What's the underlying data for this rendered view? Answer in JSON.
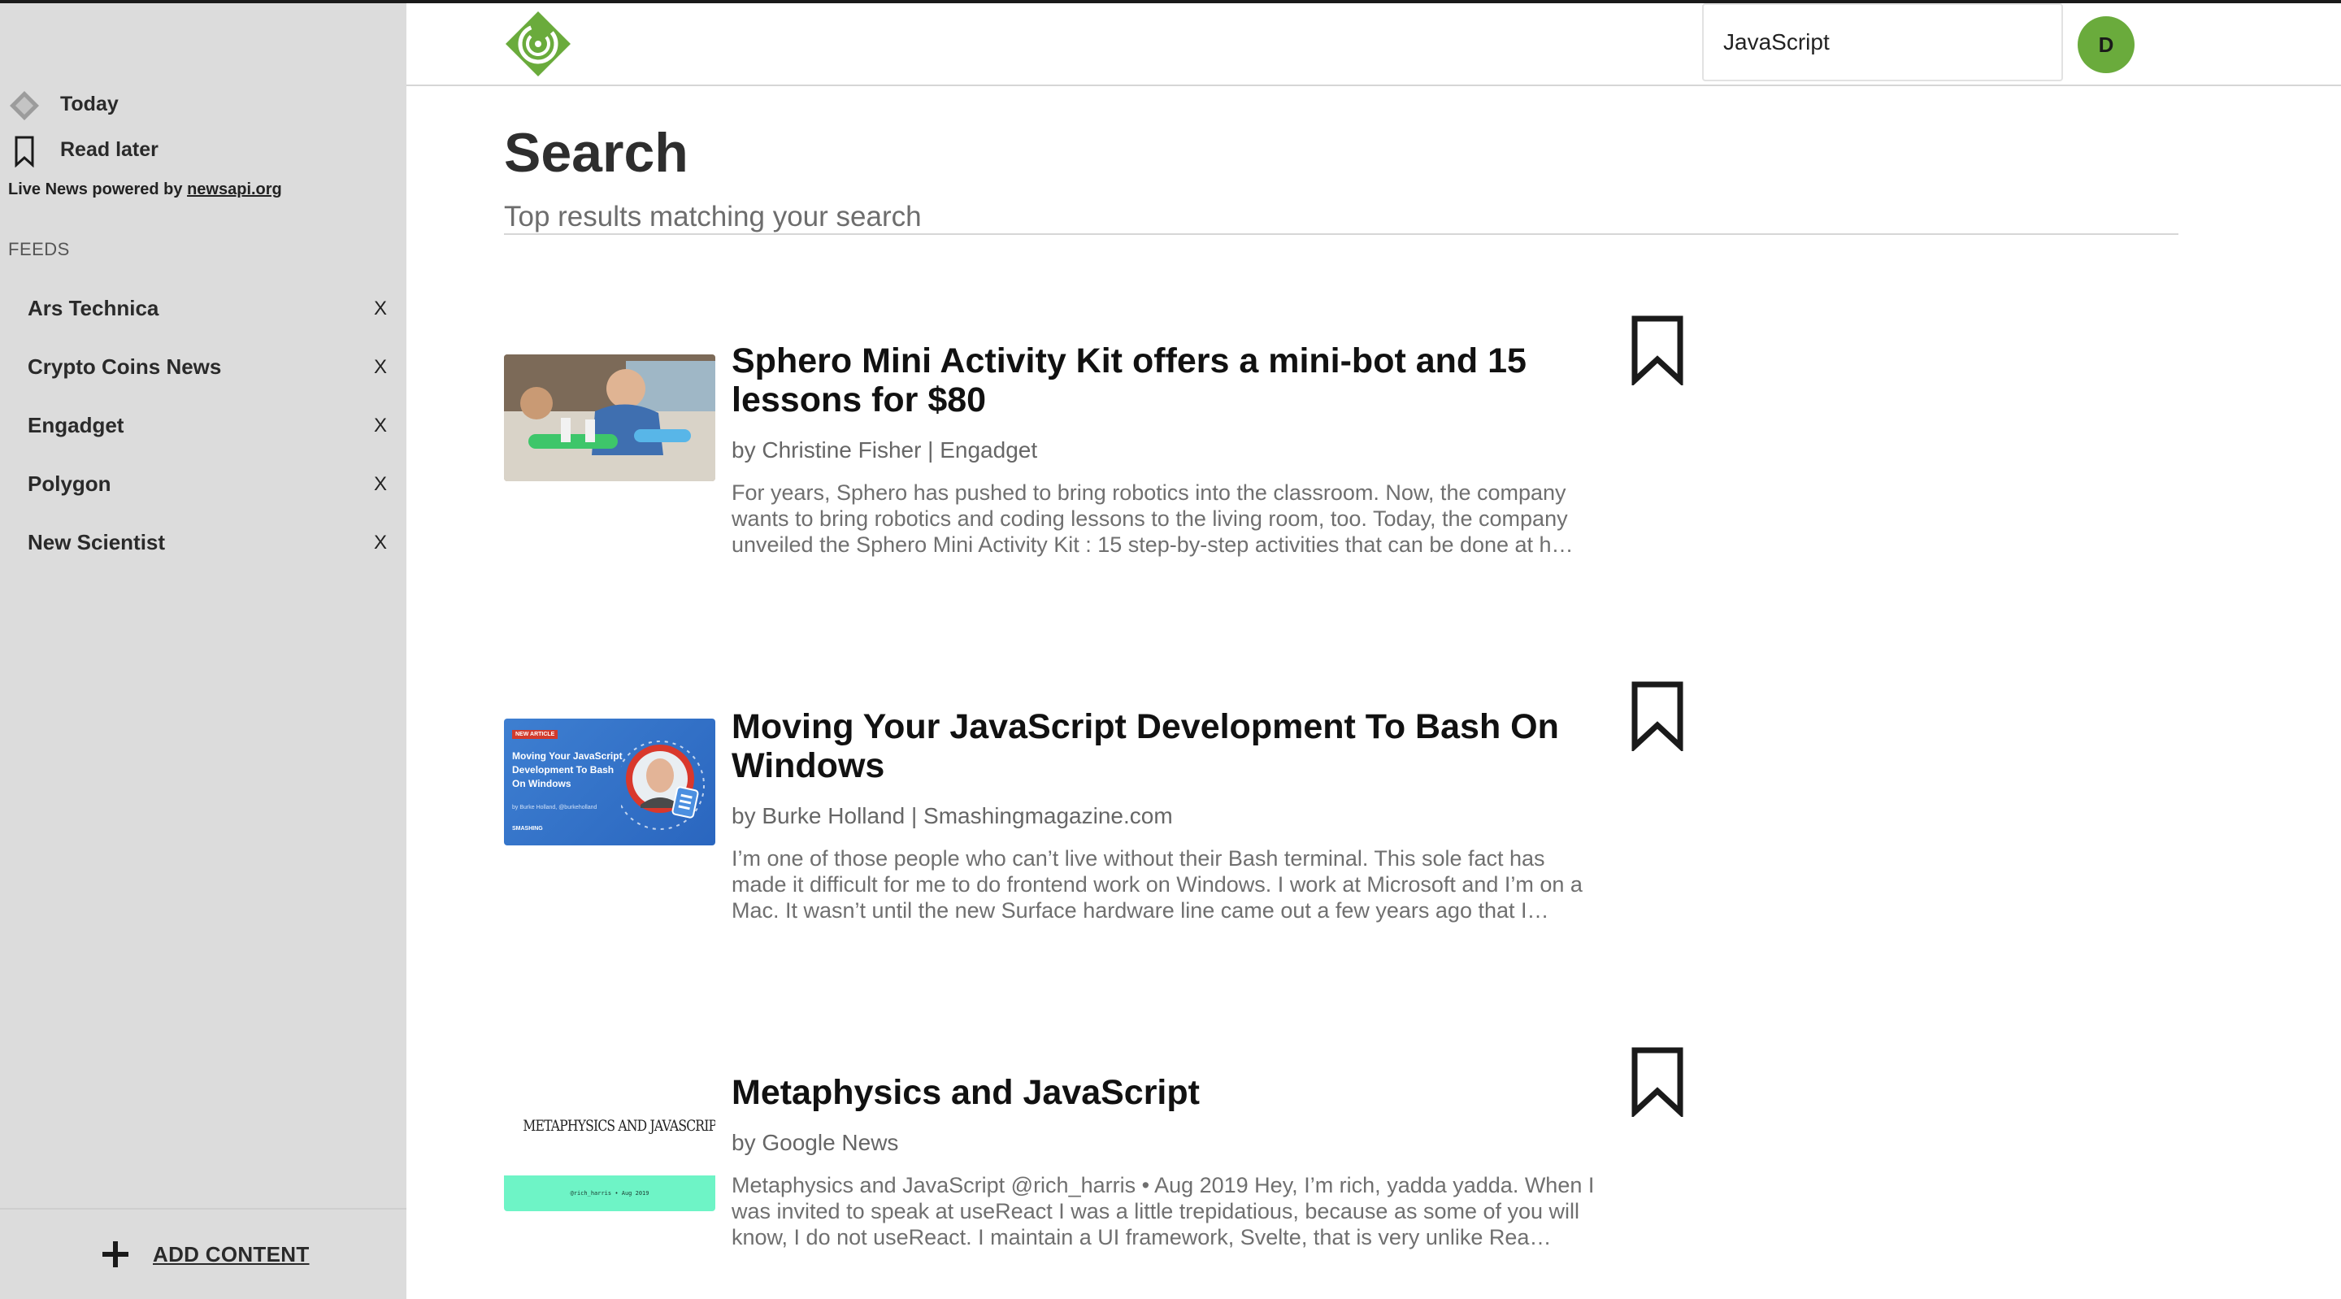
{
  "sidebar": {
    "nav": [
      {
        "label": "Today",
        "icon": "today-diamond-icon"
      },
      {
        "label": "Read later",
        "icon": "bookmark-icon"
      }
    ],
    "powered_prefix": "Live News powered by ",
    "powered_link": "newsapi.org",
    "feeds_heading": "FEEDS",
    "feeds": [
      {
        "label": "Ars Technica",
        "remove": "X"
      },
      {
        "label": "Crypto Coins News",
        "remove": "X"
      },
      {
        "label": "Engadget",
        "remove": "X"
      },
      {
        "label": "Polygon",
        "remove": "X"
      },
      {
        "label": "New Scientist",
        "remove": "X"
      }
    ],
    "add_content_label": "ADD CONTENT"
  },
  "header": {
    "search_value": "JavaScript",
    "avatar_initial": "D",
    "brand_color": "#6aab3c"
  },
  "main": {
    "title": "Search",
    "subtitle": "Top results matching your search",
    "articles": [
      {
        "title": "Sphero Mini Activity Kit offers a mini-bot and 15 lessons for $80",
        "byline": "by Christine Fisher | Engadget",
        "description": "For years, Sphero has pushed to bring robotics into the classroom. Now, the company wants to bring robotics and coding lessons to the living room, too. Today, the company unveiled the Sphero Mini Activity Kit : 15 step-by-step activities that can be done at h…"
      },
      {
        "title": "Moving Your JavaScript Development To Bash On Windows",
        "byline": "by Burke Holland | Smashingmagazine.com",
        "description": "I’m one of those people who can’t live without their Bash terminal. This sole fact has made it difficult for me to do frontend work on Windows. I work at Microsoft and I’m on a Mac. It wasn’t until the new Surface hardware line came out a few years ago that I…",
        "thumb_badge": "NEW ARTICLE",
        "thumb_title": "Moving Your JavaScript Development To Bash On Windows",
        "thumb_author": "by Burke Holland, @burkeholland",
        "thumb_brand": "SMASHING"
      },
      {
        "title": "Metaphysics and JavaScript",
        "byline": "by Google News",
        "description": "Metaphysics and JavaScript @rich_harris • Aug 2019 Hey, I’m rich, yadda yadda. When I was invited to speak at useReact I was a little trepidatious, because as some of you will know, I do not useReact. I maintain a UI framework, Svelte, that is very unlike Rea…",
        "thumb_title": "METAPHYSICS AND JAVASCRIPT",
        "thumb_footer": "@rich_harris • Aug 2019"
      }
    ]
  }
}
